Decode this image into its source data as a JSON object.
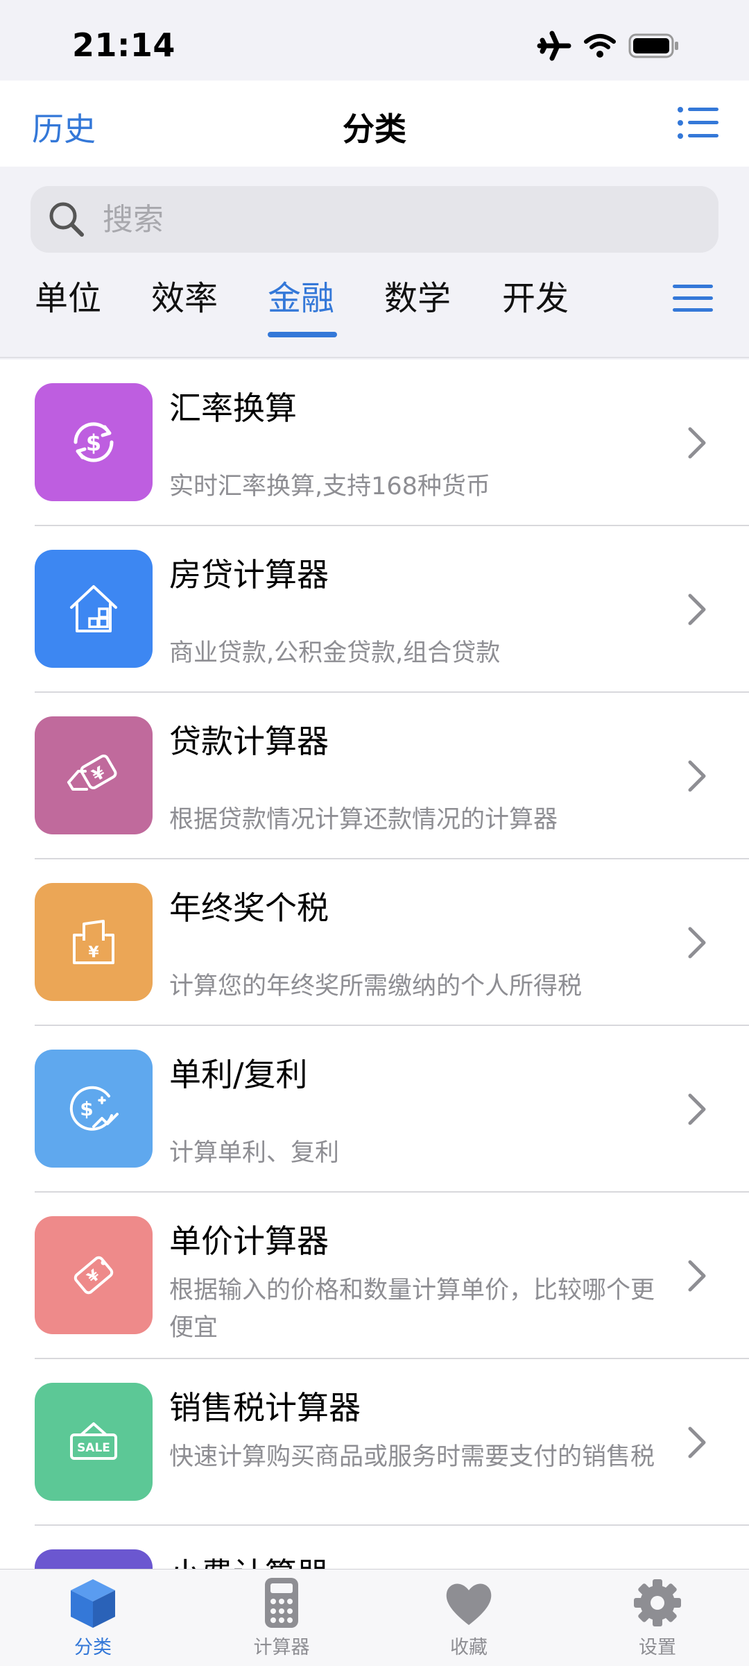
{
  "status_bar": {
    "time": "21:14"
  },
  "nav": {
    "left": "历史",
    "title": "分类"
  },
  "search": {
    "placeholder": "搜索"
  },
  "tabs": [
    {
      "label": "单位"
    },
    {
      "label": "效率"
    },
    {
      "label": "金融",
      "active": true
    },
    {
      "label": "数学"
    },
    {
      "label": "开发"
    }
  ],
  "list": [
    {
      "title": "汇率换算",
      "desc": "实时汇率换算,支持168种货币",
      "color": "#be5ee0",
      "icon": "currency-exchange-icon"
    },
    {
      "title": "房贷计算器",
      "desc": "商业贷款,公积金贷款,组合贷款",
      "color": "#3d87f2",
      "icon": "house-icon"
    },
    {
      "title": "贷款计算器",
      "desc": "根据贷款情况计算还款情况的计算器",
      "color": "#c06a9c",
      "icon": "loan-icon"
    },
    {
      "title": "年终奖个税",
      "desc": "计算您的年终奖所需缴纳的个人所得税",
      "color": "#eba656",
      "icon": "bonus-envelope-icon"
    },
    {
      "title": "单利/复利",
      "desc": "计算单利、复利",
      "color": "#5fa8ee",
      "icon": "interest-icon"
    },
    {
      "title": "单价计算器",
      "desc": "根据输入的价格和数量计算单价，比较哪个更便宜",
      "color": "#ee8a8a",
      "icon": "price-tag-icon"
    },
    {
      "title": "销售税计算器",
      "desc": "快速计算购买商品或服务时需要支付的销售税",
      "color": "#5cc896",
      "icon": "sale-sign-icon"
    },
    {
      "title": "小费计算器",
      "desc": "",
      "color": "#6b57d0",
      "icon": "tip-icon"
    }
  ],
  "tab_bar": [
    {
      "label": "分类",
      "icon": "cube-icon",
      "active": true
    },
    {
      "label": "计算器",
      "icon": "calculator-icon"
    },
    {
      "label": "收藏",
      "icon": "heart-icon"
    },
    {
      "label": "设置",
      "icon": "gear-icon"
    }
  ],
  "colors": {
    "accent": "#3478d8",
    "background": "#f2f2f7"
  }
}
